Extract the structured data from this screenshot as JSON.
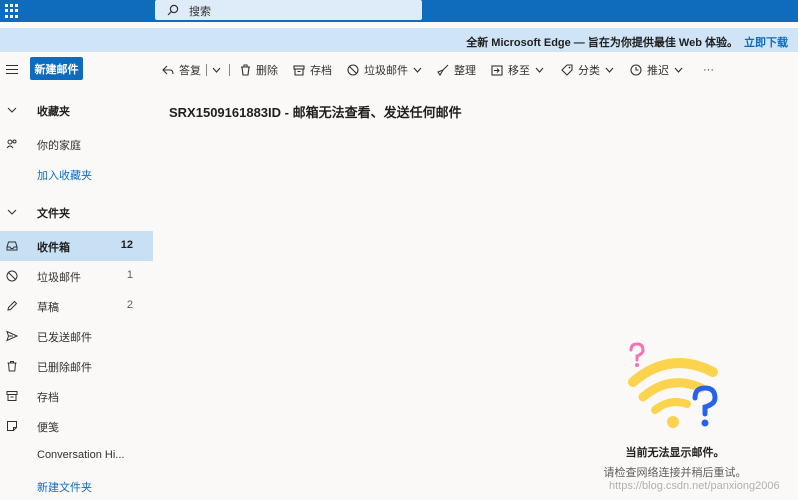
{
  "topbar": {
    "app_launcher_icon": "waffle-icon",
    "search_placeholder": "搜索",
    "accent": "#0f6cbd"
  },
  "banner": {
    "message": "全新 Microsoft Edge — 旨在为你提供最佳 Web 体验。",
    "link": "立即下载"
  },
  "commandbar": {
    "new_mail": "新建邮件",
    "reply": "答复",
    "delete": "删除",
    "archive": "存档",
    "junk": "垃圾邮件",
    "sweep": "整理",
    "move_to": "移至",
    "categorize": "分类",
    "snooze": "推迟",
    "more": "···"
  },
  "sidebar": {
    "favorites": "收藏夹",
    "family": "你的家庭",
    "add_favorite": "加入收藏夹",
    "folders": "文件夹",
    "items": [
      {
        "label": "收件箱",
        "count": "12",
        "icon": "inbox-icon"
      },
      {
        "label": "垃圾邮件",
        "count": "1",
        "icon": "junk-icon"
      },
      {
        "label": "草稿",
        "count": "2",
        "icon": "drafts-icon"
      },
      {
        "label": "已发送邮件",
        "count": "",
        "icon": "sent-icon"
      },
      {
        "label": "已删除邮件",
        "count": "",
        "icon": "deleted-icon"
      },
      {
        "label": "存档",
        "count": "",
        "icon": "archive-icon"
      },
      {
        "label": "便笺",
        "count": "",
        "icon": "notes-icon"
      },
      {
        "label": "Conversation Hi...",
        "count": "",
        "icon": ""
      }
    ],
    "new_folder": "新建文件夹"
  },
  "pane": {
    "subject": "SRX1509161883ID - 邮箱无法查看、发送任何邮件",
    "empty_title": "当前无法显示邮件。",
    "empty_subtitle": "请检查网络连接并稍后重试。",
    "watermark": "https://blog.csdn.net/panxiong2006"
  }
}
